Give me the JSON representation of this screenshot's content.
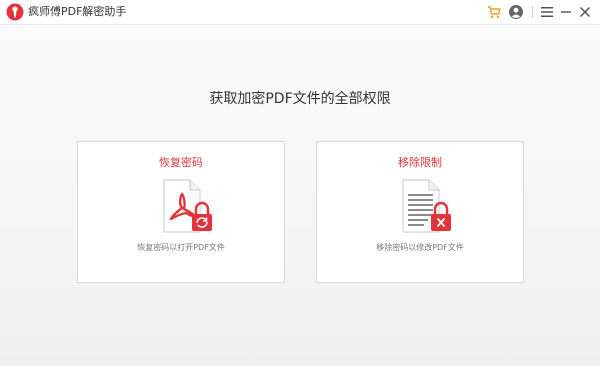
{
  "app": {
    "title": "疯师傅PDF解密助手",
    "accent_color": "#e2343b",
    "toolbar_icons": [
      "cart-icon",
      "user-icon",
      "menu-icon",
      "minimize-icon",
      "close-icon"
    ]
  },
  "main": {
    "headline": "获取加密PDF文件的全部权限",
    "cards": [
      {
        "title": "恢复密码",
        "description": "恢复密码以打开PDF文件",
        "icon": "pdf-lock-icon"
      },
      {
        "title": "移除限制",
        "description": "移除密码以修改PDF文件",
        "icon": "document-unlock-icon"
      }
    ]
  }
}
